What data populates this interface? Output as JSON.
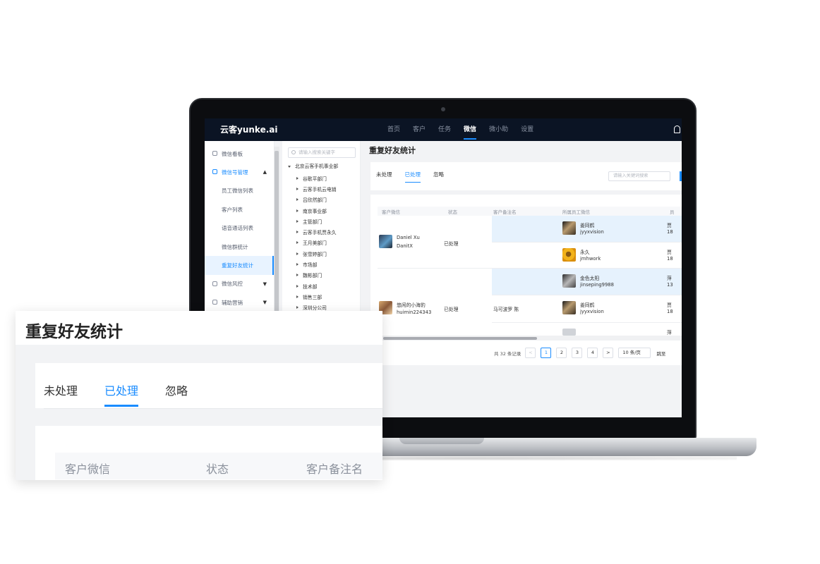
{
  "app": {
    "brand": "云客yunke.ai",
    "nav": [
      "首页",
      "客户",
      "任务",
      "微信",
      "微小助",
      "设置"
    ],
    "nav_active": "微信"
  },
  "sidebar": {
    "items": [
      {
        "label": "微信看板",
        "icon": "dashboard-icon"
      },
      {
        "label": "微信号管理",
        "icon": "phone-icon",
        "expanded": true
      },
      {
        "label": "员工微信列表"
      },
      {
        "label": "客户列表"
      },
      {
        "label": "语音通话列表"
      },
      {
        "label": "微信群统计"
      },
      {
        "label": "重复好友统计",
        "selected": true
      },
      {
        "label": "微信风控",
        "icon": "shield-icon"
      },
      {
        "label": "辅助营销",
        "icon": "target-icon"
      }
    ]
  },
  "tree": {
    "search_placeholder": "请输入搜索关键字",
    "root": "北京云客手机事业部",
    "nodes": [
      "谷歌平部门",
      "云客手机云电销",
      "吕欣然部门",
      "南京事业部",
      "主管部门",
      "云客手机贾永久",
      "王月美部门",
      "张雪婷部门",
      "市场部",
      "魏彬部门",
      "技术部",
      "销售三部",
      "深圳分公司"
    ]
  },
  "page": {
    "title": "重复好友统计",
    "tabs": [
      "未处理",
      "已处理",
      "忽略"
    ],
    "active_tab": "已处理",
    "search_placeholder": "请输入关键词搜索"
  },
  "table": {
    "columns": [
      "客户微信",
      "状态",
      "客户备注名",
      "所属员工微信",
      "员"
    ],
    "groups": [
      {
        "customer_name": "Daniel Xu",
        "customer_id": "DanitX",
        "status": "已处理",
        "remark": "",
        "employees": [
          {
            "name": "姜同鹤",
            "wechat": "jyyxvision",
            "extra": "贾",
            "extra2": "18"
          },
          {
            "name": "永久",
            "wechat": "jmhwork",
            "extra": "贾",
            "extra2": "18"
          }
        ]
      },
      {
        "customer_name": "悠闲的小海豹",
        "customer_id": "huimin224343",
        "status": "已处理",
        "remark": "马可波罗 陈",
        "employees": [
          {
            "name": "金色太阳",
            "wechat": "jinseping9988",
            "extra": "萍",
            "extra2": "13"
          },
          {
            "name": "姜同鹤",
            "wechat": "jyyxvision",
            "extra": "贾",
            "extra2": "18"
          },
          {
            "name": "",
            "wechat": "",
            "extra": "萍",
            "extra2": ""
          }
        ]
      }
    ]
  },
  "pagination": {
    "total": "共 32 条记录",
    "prev": "<",
    "pages": [
      "1",
      "2",
      "3",
      "4"
    ],
    "current": "1",
    "next": ">",
    "page_size": "10 条/页",
    "jump": "跳至"
  },
  "zoom": {
    "title": "重复好友统计",
    "tabs": [
      "未处理",
      "已处理",
      "忽略"
    ],
    "active_tab": "已处理",
    "columns": [
      "客户微信",
      "状态",
      "客户备注名"
    ]
  },
  "colors": {
    "accent": "#1a8cff",
    "nav_bg": "#0b1424",
    "row_highlight": "#e6f2fd"
  }
}
